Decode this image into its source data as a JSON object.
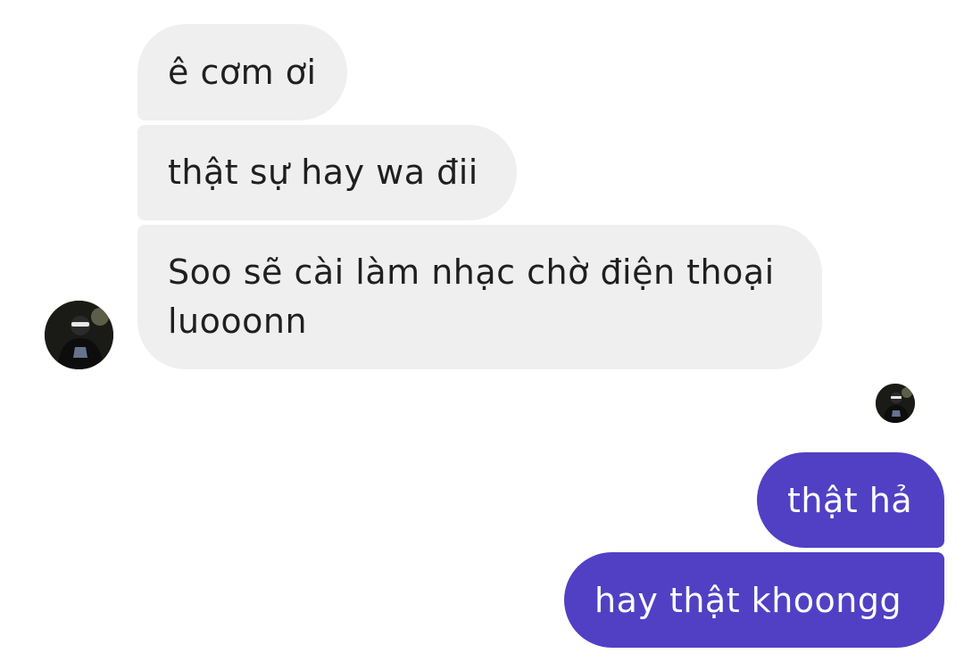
{
  "conversation": {
    "incoming": [
      {
        "text": "ê cơm ơi"
      },
      {
        "text": "thật sự hay wa đii"
      },
      {
        "text": "Soo sẽ cài làm nhạc chờ điện thoại luooonn"
      }
    ],
    "outgoing": [
      {
        "text": "thật hả"
      },
      {
        "text": "hay thật khoongg"
      }
    ]
  },
  "colors": {
    "incoming_bubble": "#efefef",
    "outgoing_bubble": "#5140c4",
    "incoming_text": "#1f1f1f",
    "outgoing_text": "#ffffff"
  },
  "icons": {
    "sender_avatar": "contact-avatar-icon",
    "read_receipt": "seen-avatar-icon"
  }
}
